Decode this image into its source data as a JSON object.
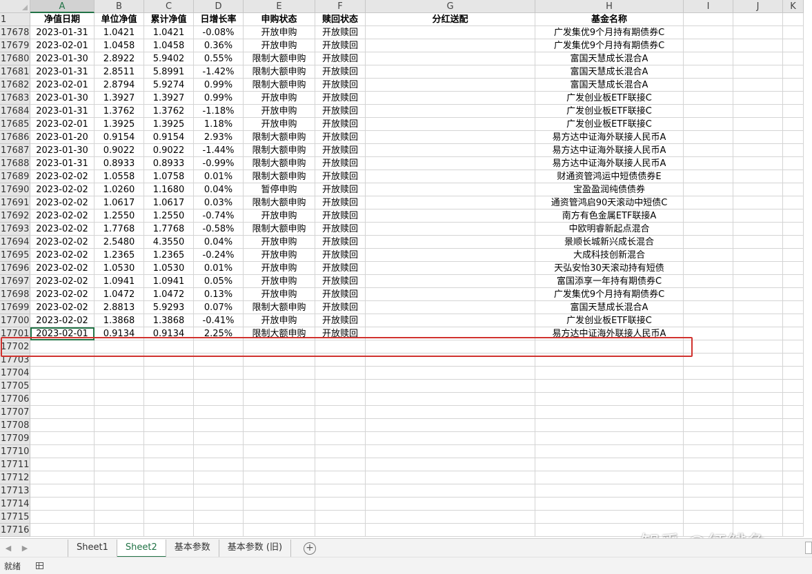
{
  "columns": [
    {
      "letter": "A",
      "w": 93,
      "selected": true
    },
    {
      "letter": "B",
      "w": 72
    },
    {
      "letter": "C",
      "w": 72
    },
    {
      "letter": "D",
      "w": 72
    },
    {
      "letter": "E",
      "w": 104
    },
    {
      "letter": "F",
      "w": 73
    },
    {
      "letter": "G",
      "w": 246
    },
    {
      "letter": "H",
      "w": 215
    },
    {
      "letter": "I",
      "w": 72
    },
    {
      "letter": "J",
      "w": 72
    },
    {
      "letter": "K",
      "w": 30
    }
  ],
  "header_row": {
    "num": "1",
    "cells": [
      "净值日期",
      "单位净值",
      "累计净值",
      "日增长率",
      "申购状态",
      "赎回状态",
      "分红送配",
      "基金名称",
      "",
      "",
      ""
    ]
  },
  "data_rows": [
    {
      "num": "17678",
      "cells": [
        "2023-01-31",
        "1.0421",
        "1.0421",
        "-0.08%",
        "开放申购",
        "开放赎回",
        "",
        "广发集优9个月持有期债券C"
      ]
    },
    {
      "num": "17679",
      "cells": [
        "2023-02-01",
        "1.0458",
        "1.0458",
        "0.36%",
        "开放申购",
        "开放赎回",
        "",
        "广发集优9个月持有期债券C"
      ]
    },
    {
      "num": "17680",
      "cells": [
        "2023-01-30",
        "2.8922",
        "5.9402",
        "0.55%",
        "限制大额申购",
        "开放赎回",
        "",
        "富国天慧成长混合A"
      ]
    },
    {
      "num": "17681",
      "cells": [
        "2023-01-31",
        "2.8511",
        "5.8991",
        "-1.42%",
        "限制大额申购",
        "开放赎回",
        "",
        "富国天慧成长混合A"
      ]
    },
    {
      "num": "17682",
      "cells": [
        "2023-02-01",
        "2.8794",
        "5.9274",
        "0.99%",
        "限制大额申购",
        "开放赎回",
        "",
        "富国天慧成长混合A"
      ]
    },
    {
      "num": "17683",
      "cells": [
        "2023-01-30",
        "1.3927",
        "1.3927",
        "0.99%",
        "开放申购",
        "开放赎回",
        "",
        "广发创业板ETF联接C"
      ]
    },
    {
      "num": "17684",
      "cells": [
        "2023-01-31",
        "1.3762",
        "1.3762",
        "-1.18%",
        "开放申购",
        "开放赎回",
        "",
        "广发创业板ETF联接C"
      ]
    },
    {
      "num": "17685",
      "cells": [
        "2023-02-01",
        "1.3925",
        "1.3925",
        "1.18%",
        "开放申购",
        "开放赎回",
        "",
        "广发创业板ETF联接C"
      ]
    },
    {
      "num": "17686",
      "cells": [
        "2023-01-20",
        "0.9154",
        "0.9154",
        "2.93%",
        "限制大额申购",
        "开放赎回",
        "",
        "易方达中证海外联接人民币A"
      ]
    },
    {
      "num": "17687",
      "cells": [
        "2023-01-30",
        "0.9022",
        "0.9022",
        "-1.44%",
        "限制大额申购",
        "开放赎回",
        "",
        "易方达中证海外联接人民币A"
      ]
    },
    {
      "num": "17688",
      "cells": [
        "2023-01-31",
        "0.8933",
        "0.8933",
        "-0.99%",
        "限制大额申购",
        "开放赎回",
        "",
        "易方达中证海外联接人民币A"
      ]
    },
    {
      "num": "17689",
      "cells": [
        "2023-02-02",
        "1.0558",
        "1.0758",
        "0.01%",
        "限制大额申购",
        "开放赎回",
        "",
        "财通资管鸿运中短债债券E"
      ]
    },
    {
      "num": "17690",
      "cells": [
        "2023-02-02",
        "1.0260",
        "1.1680",
        "0.04%",
        "暂停申购",
        "开放赎回",
        "",
        "宝盈盈润纯债债券"
      ]
    },
    {
      "num": "17691",
      "cells": [
        "2023-02-02",
        "1.0617",
        "1.0617",
        "0.03%",
        "限制大额申购",
        "开放赎回",
        "",
        "通资管鸿启90天滚动中短债C"
      ]
    },
    {
      "num": "17692",
      "cells": [
        "2023-02-02",
        "1.2550",
        "1.2550",
        "-0.74%",
        "开放申购",
        "开放赎回",
        "",
        "南方有色金属ETF联接A"
      ]
    },
    {
      "num": "17693",
      "cells": [
        "2023-02-02",
        "1.7768",
        "1.7768",
        "-0.58%",
        "限制大额申购",
        "开放赎回",
        "",
        "中欧明睿新起点混合"
      ]
    },
    {
      "num": "17694",
      "cells": [
        "2023-02-02",
        "2.5480",
        "4.3550",
        "0.04%",
        "开放申购",
        "开放赎回",
        "",
        "景顺长城新兴成长混合"
      ]
    },
    {
      "num": "17695",
      "cells": [
        "2023-02-02",
        "1.2365",
        "1.2365",
        "-0.24%",
        "开放申购",
        "开放赎回",
        "",
        "大成科技创新混合"
      ]
    },
    {
      "num": "17696",
      "cells": [
        "2023-02-02",
        "1.0530",
        "1.0530",
        "0.01%",
        "开放申购",
        "开放赎回",
        "",
        "天弘安怡30天滚动持有短债"
      ]
    },
    {
      "num": "17697",
      "cells": [
        "2023-02-02",
        "1.0941",
        "1.0941",
        "0.05%",
        "开放申购",
        "开放赎回",
        "",
        "富国添享一年持有期债券C"
      ]
    },
    {
      "num": "17698",
      "cells": [
        "2023-02-02",
        "1.0472",
        "1.0472",
        "0.13%",
        "开放申购",
        "开放赎回",
        "",
        "广发集优9个月持有期债券C"
      ]
    },
    {
      "num": "17699",
      "cells": [
        "2023-02-02",
        "2.8813",
        "5.9293",
        "0.07%",
        "限制大额申购",
        "开放赎回",
        "",
        "富国天慧成长混合A"
      ]
    },
    {
      "num": "17700",
      "cells": [
        "2023-02-02",
        "1.3868",
        "1.3868",
        "-0.41%",
        "开放申购",
        "开放赎回",
        "",
        "广发创业板ETF联接C"
      ]
    },
    {
      "num": "17701",
      "cells": [
        "2023-02-01",
        "0.9134",
        "0.9134",
        "2.25%",
        "限制大额申购",
        "开放赎回",
        "",
        "易方达中证海外联接人民币A"
      ]
    }
  ],
  "empty_rows": [
    "17702",
    "17703",
    "17704",
    "17705",
    "17706",
    "17707",
    "17708",
    "17709",
    "17710",
    "17711",
    "17712",
    "17713",
    "17714",
    "17715",
    "17716"
  ],
  "sheet_tabs": [
    {
      "label": "Sheet1",
      "active": false
    },
    {
      "label": "Sheet2",
      "active": true
    },
    {
      "label": "基本参数",
      "active": false
    },
    {
      "label": "基本参数 (旧)",
      "active": false
    }
  ],
  "add_sheet_symbol": "+",
  "status": {
    "text": "就绪"
  },
  "watermark": "知乎 @红鲱鱼",
  "colors": {
    "accent": "#217346",
    "highlight_box": "#d0312d"
  }
}
